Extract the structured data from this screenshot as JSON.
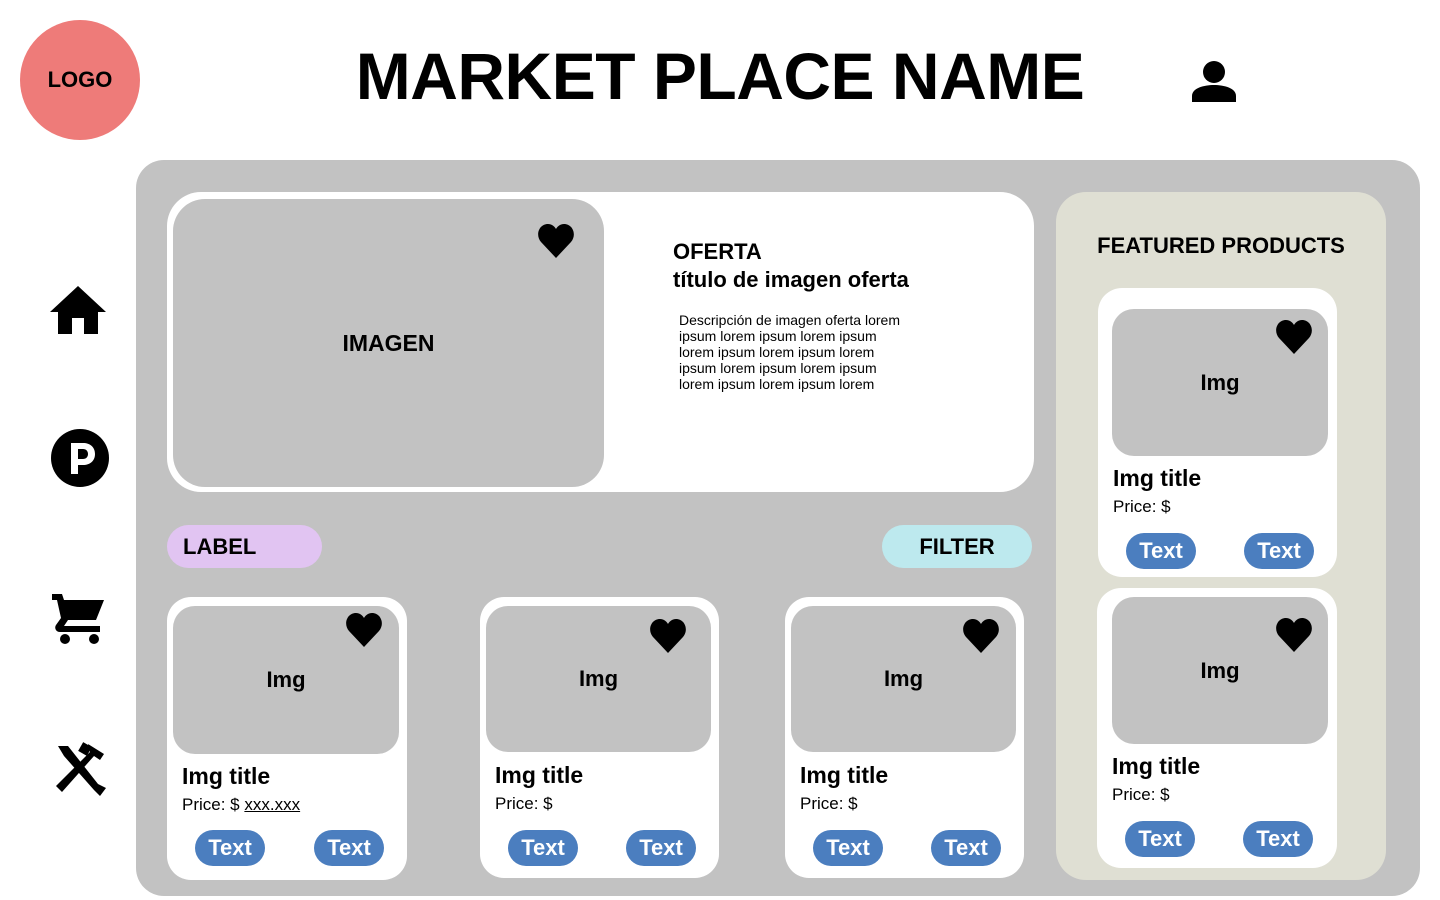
{
  "header": {
    "logo_text": "LOGO",
    "title": "MARKET PLACE NAME",
    "user_icon": "user-icon"
  },
  "nav": [
    {
      "icon": "home-icon"
    },
    {
      "icon": "parking-icon"
    },
    {
      "icon": "cart-icon"
    },
    {
      "icon": "tools-icon"
    }
  ],
  "offer": {
    "image_label": "IMAGEN",
    "kicker": "OFERTA",
    "title": "título de imagen oferta",
    "description": "Descripción de imagen oferta lorem ipsum lorem ipsum lorem ipsum lorem ipsum lorem ipsum lorem ipsum lorem ipsum lorem ipsum lorem ipsum lorem ipsum lorem",
    "heart_icon": "heart-icon"
  },
  "toolbar": {
    "label": "LABEL",
    "filter": "FILTER"
  },
  "products": [
    {
      "img": "Img",
      "title": "Img title",
      "price_prefix": "Price: $",
      "price_value": "xxx.xxx",
      "btn1": "Text",
      "btn2": "Text"
    },
    {
      "img": "Img",
      "title": "Img title",
      "price_prefix": "Price: $",
      "price_value": "",
      "btn1": "Text",
      "btn2": "Text"
    },
    {
      "img": "Img",
      "title": "Img title",
      "price_prefix": "Price: $",
      "price_value": "",
      "btn1": "Text",
      "btn2": "Text"
    }
  ],
  "featured": {
    "heading": "FEATURED PRODUCTS",
    "items": [
      {
        "img": "Img",
        "title": "Img title",
        "price_prefix": "Price: $",
        "btn1": "Text",
        "btn2": "Text"
      },
      {
        "img": "Img",
        "title": "Img title",
        "price_prefix": "Price: $",
        "btn1": "Text",
        "btn2": "Text"
      }
    ]
  },
  "colors": {
    "logo": "#ee7b79",
    "panel": "#c2c2c2",
    "featured_panel": "#dfdfd3",
    "label_pill": "#e1c4f2",
    "filter_pill": "#bde9ee",
    "button": "#4b7ebf"
  }
}
